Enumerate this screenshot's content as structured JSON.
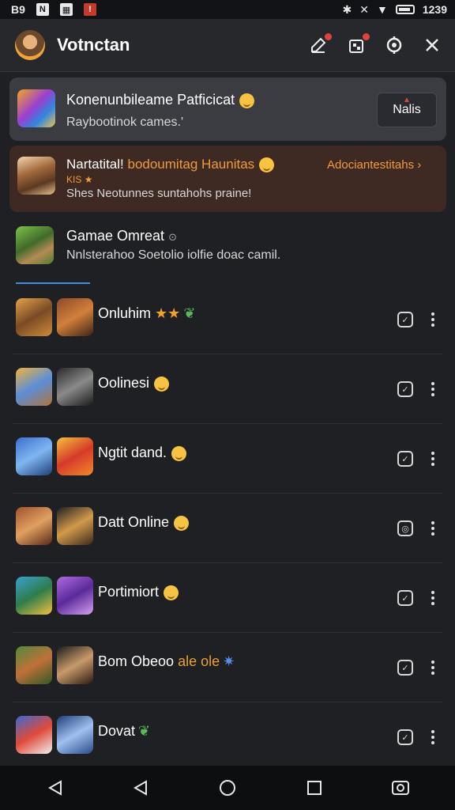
{
  "status_bar": {
    "left_text": "B9",
    "time": "1239",
    "icons": [
      "n-icon",
      "picture-icon",
      "alert-icon",
      "bluetooth-icon",
      "mute-icon",
      "wifi-icon",
      "battery-icon"
    ]
  },
  "app_bar": {
    "title": "Votnctan",
    "actions": [
      "edit-icon",
      "store-icon",
      "location-icon",
      "close-icon"
    ]
  },
  "card1": {
    "title": "Konenunbileame Patficicat",
    "subtitle": "Raybootinok cames.'",
    "button_label": "Nalis"
  },
  "card2": {
    "title_part1": "Nartatital!",
    "title_part2": "bodoumitag Haunitas",
    "title_part3": "Adociantestitahs",
    "tag": "KIS",
    "subtitle": "Shes Neotunnes suntahohs praine!"
  },
  "featured": {
    "title": "Gamae Omreat",
    "subtitle": "Nnlsterahoo Soetolio iolfie doac camil."
  },
  "list": [
    {
      "title": "Onluhim",
      "decor": "stars-leaf"
    },
    {
      "title": "Oolinesi",
      "decor": "emoji"
    },
    {
      "title": "Ngtit dand.",
      "decor": "emoji"
    },
    {
      "title": "Datt Online",
      "decor": "emoji"
    },
    {
      "title": "Portimiort",
      "decor": "emoji"
    },
    {
      "title": "Bom Obeoo",
      "decor": "ale ole star",
      "extra": "ale ole"
    },
    {
      "title": "Dovat",
      "decor": "leaf"
    }
  ],
  "colors": {
    "background": "#1f2024",
    "accent": "#3c8de0",
    "orange": "#f19a3e",
    "badge": "#e0453a"
  }
}
